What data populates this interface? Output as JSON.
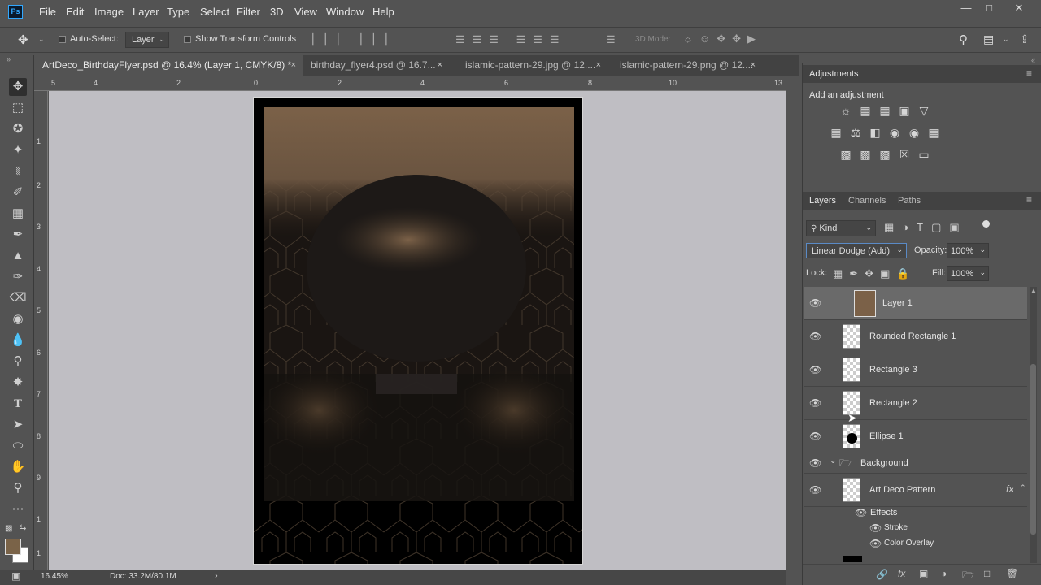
{
  "app": {
    "logo": "Ps",
    "menus": [
      "File",
      "Edit",
      "Image",
      "Layer",
      "Type",
      "Select",
      "Filter",
      "3D",
      "View",
      "Window",
      "Help"
    ],
    "window_controls": [
      "minimize-icon",
      "restore-icon",
      "close-icon"
    ]
  },
  "options": {
    "auto_select_label": "Auto-Select:",
    "auto_select_value": "Layer",
    "show_transform_label": "Show Transform Controls",
    "mode_3d_label": "3D Mode:"
  },
  "tabs": [
    {
      "label": "ArtDeco_BirthdayFlyer.psd @ 16.4% (Layer 1, CMYK/8) *",
      "close": "×"
    },
    {
      "label": "birthday_flyer4.psd @ 16.7...",
      "close": "×"
    },
    {
      "label": "islamic-pattern-29.jpg @ 12....",
      "close": "×"
    },
    {
      "label": "islamic-pattern-29.png @ 12....",
      "close": "×"
    }
  ],
  "ruler": {
    "top": [
      "5",
      "4",
      "2",
      "0",
      "2",
      "4",
      "6",
      "8",
      "10",
      "13"
    ],
    "left": [
      "1",
      "2",
      "3",
      "4",
      "5",
      "6",
      "7",
      "8",
      "9",
      "1",
      "1"
    ]
  },
  "status": {
    "zoom": "16.45%",
    "doc": "Doc: 33.2M/80.1M",
    "arrow": "›"
  },
  "adjustments": {
    "tab": "Adjustments",
    "subtitle": "Add an adjustment"
  },
  "layers_panel": {
    "tabs": [
      "Layers",
      "Channels",
      "Paths"
    ],
    "filter_label": "Kind",
    "blend_mode": "Linear Dodge (Add)",
    "opacity_label": "Opacity:",
    "opacity_value": "100%",
    "lock_label": "Lock:",
    "fill_label": "Fill:",
    "fill_value": "100%",
    "layers": [
      "Layer 1",
      "Rounded Rectangle 1",
      "Rectangle 3",
      "Rectangle 2",
      "Ellipse 1"
    ],
    "group": "Background",
    "pattern_layer": "Art Deco Pattern",
    "fx": "fx",
    "effects_label": "Effects",
    "effects": [
      "Stroke",
      "Color Overlay"
    ]
  },
  "colors": {
    "accent": "#31a8ff",
    "foreground": "#7a6348",
    "background": "#ffffff",
    "layer_brown": "#7b6148"
  }
}
